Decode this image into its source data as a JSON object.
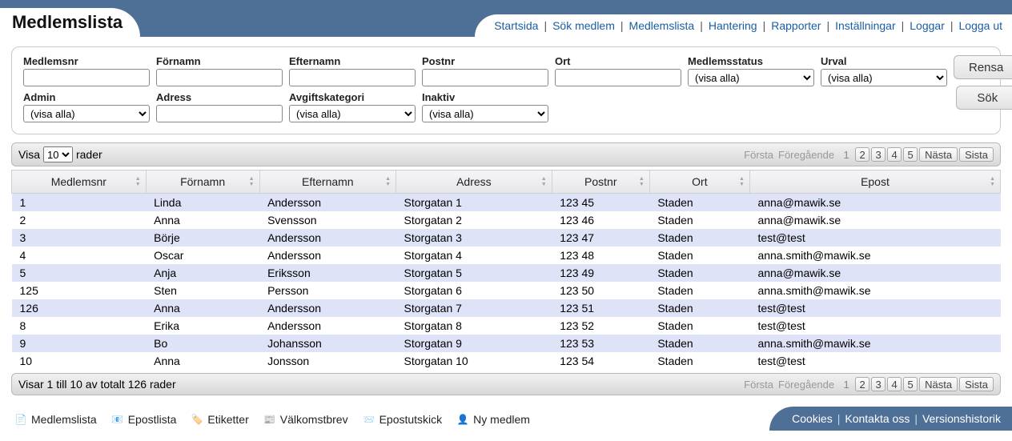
{
  "page_title": "Medlemslista",
  "nav": [
    "Startsida",
    "Sök medlem",
    "Medlemslista",
    "Hantering",
    "Rapporter",
    "Inställningar",
    "Loggar",
    "Logga ut"
  ],
  "filters": {
    "row1": [
      {
        "label": "Medlemsnr",
        "type": "text",
        "value": ""
      },
      {
        "label": "Förnamn",
        "type": "text",
        "value": ""
      },
      {
        "label": "Efternamn",
        "type": "text",
        "value": ""
      },
      {
        "label": "Postnr",
        "type": "text",
        "value": ""
      },
      {
        "label": "Ort",
        "type": "text",
        "value": ""
      },
      {
        "label": "Medlemsstatus",
        "type": "select",
        "value": "(visa alla)"
      },
      {
        "label": "Urval",
        "type": "select",
        "value": "(visa alla)"
      }
    ],
    "row2": [
      {
        "label": "Admin",
        "type": "select",
        "value": "(visa alla)"
      },
      {
        "label": "Adress",
        "type": "text",
        "value": ""
      },
      {
        "label": "Avgiftskategori",
        "type": "select",
        "value": "(visa alla)"
      },
      {
        "label": "Inaktiv",
        "type": "select",
        "value": "(visa alla)"
      }
    ],
    "buttons": {
      "clear": "Rensa",
      "search": "Sök"
    }
  },
  "lengthcontrol": {
    "prefix": "Visa",
    "value": "10",
    "suffix": "rader"
  },
  "pager": {
    "first": "Första",
    "prev": "Föregående",
    "pages": [
      "1",
      "2",
      "3",
      "4",
      "5"
    ],
    "current": "1",
    "next": "Nästa",
    "last": "Sista"
  },
  "columns": [
    "Medlemsnr",
    "Förnamn",
    "Efternamn",
    "Adress",
    "Postnr",
    "Ort",
    "Epost"
  ],
  "rows": [
    [
      "1",
      "Linda",
      "Andersson",
      "Storgatan 1",
      "123 45",
      "Staden",
      "anna@mawik.se"
    ],
    [
      "2",
      "Anna",
      "Svensson",
      "Storgatan 2",
      "123 46",
      "Staden",
      "anna@mawik.se"
    ],
    [
      "3",
      "Börje",
      "Andersson",
      "Storgatan 3",
      "123 47",
      "Staden",
      "test@test"
    ],
    [
      "4",
      "Oscar",
      "Andersson",
      "Storgatan 4",
      "123 48",
      "Staden",
      "anna.smith@mawik.se"
    ],
    [
      "5",
      "Anja",
      "Eriksson",
      "Storgatan 5",
      "123 49",
      "Staden",
      "anna@mawik.se"
    ],
    [
      "125",
      "Sten",
      "Persson",
      "Storgatan 6",
      "123 50",
      "Staden",
      "anna.smith@mawik.se"
    ],
    [
      "126",
      "Anna",
      "Andersson",
      "Storgatan 7",
      "123 51",
      "Staden",
      "test@test"
    ],
    [
      "8",
      "Erika",
      "Andersson",
      "Storgatan 8",
      "123 52",
      "Staden",
      "test@test"
    ],
    [
      "9",
      "Bo",
      "Johansson",
      "Storgatan 9",
      "123 53",
      "Staden",
      "anna.smith@mawik.se"
    ],
    [
      "10",
      "Anna",
      "Jonsson",
      "Storgatan 10",
      "123 54",
      "Staden",
      "test@test"
    ]
  ],
  "footer_info": "Visar 1 till 10 av totalt 126 rader",
  "tools": [
    {
      "icon": "list-icon",
      "glyph": "📄",
      "label": "Medlemslista"
    },
    {
      "icon": "mail-list-icon",
      "glyph": "📧",
      "label": "Epostlista"
    },
    {
      "icon": "labels-icon",
      "glyph": "🏷️",
      "label": "Etiketter"
    },
    {
      "icon": "welcome-icon",
      "glyph": "📰",
      "label": "Välkomstbrev"
    },
    {
      "icon": "mailshot-icon",
      "glyph": "📨",
      "label": "Epostutskick"
    },
    {
      "icon": "new-member-icon",
      "glyph": "👤",
      "label": "Ny medlem"
    }
  ],
  "bottom_links": [
    "Cookies",
    "Kontakta oss",
    "Versionshistorik"
  ]
}
